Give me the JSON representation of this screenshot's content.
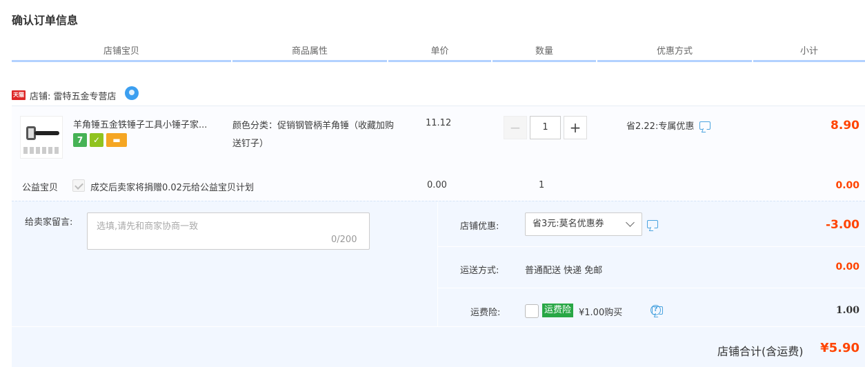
{
  "page": {
    "title": "确认订单信息"
  },
  "columns": [
    "店铺宝贝",
    "商品属性",
    "单价",
    "数量",
    "优惠方式",
    "小计"
  ],
  "shop": {
    "badge": "天猫",
    "label": "店铺: 雷特五金专营店"
  },
  "item": {
    "name": "羊角锤五金铁锤子工具小锤子家...",
    "service_icons": [
      "7",
      "checkmark-badge-icon",
      "card-icon"
    ],
    "property": "颜色分类：促销钢管柄羊角锤（收藏加购送钉子）",
    "price": "11.12",
    "qty_minus": "−",
    "qty_value": "1",
    "qty_plus": "+",
    "promo": "省2.22:专属优惠",
    "subtotal": "8.90"
  },
  "charity": {
    "label": "公益宝贝",
    "text": "成交后卖家将捐赠0.02元给公益宝贝计划",
    "price": "0.00",
    "qty": "1",
    "subtotal": "0.00"
  },
  "message": {
    "label": "给卖家留言:",
    "placeholder": "选填,请先和商家协商一致",
    "count": "0/200"
  },
  "shop_discount": {
    "label": "店铺优惠:",
    "selected": "省3元:莫名优惠券",
    "amount": "-3.00"
  },
  "shipping": {
    "label": "运送方式:",
    "value": "普通配送 快递 免邮",
    "amount": "0.00"
  },
  "insurance": {
    "label": "运费险:",
    "tag": "运费险",
    "price": "¥1.00购买",
    "help": "?",
    "amount": "1.00"
  },
  "total": {
    "label": "店铺合计(含运费)",
    "amount": "¥5.90"
  },
  "colors": {
    "accent_red": "#ff4400",
    "header_line": "#b2d1ff",
    "panel_bg": "#f2f7ff",
    "insurance_green": "#28a745"
  }
}
